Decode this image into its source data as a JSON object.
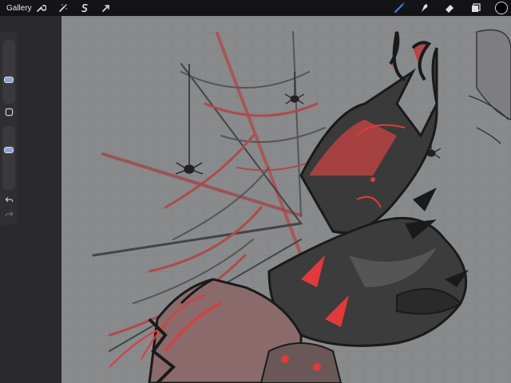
{
  "topbar": {
    "gallery_label": "Gallery",
    "left_tools": [
      {
        "name": "actions",
        "icon": "wrench-icon"
      },
      {
        "name": "adjustments",
        "icon": "magic-wand-icon"
      },
      {
        "name": "selection",
        "icon": "selection-s-icon"
      },
      {
        "name": "transform",
        "icon": "arrow-cursor-icon"
      }
    ],
    "right_tools": [
      {
        "name": "brush",
        "icon": "brush-icon",
        "active": true
      },
      {
        "name": "smudge",
        "icon": "smudge-icon"
      },
      {
        "name": "eraser",
        "icon": "eraser-icon"
      },
      {
        "name": "layers",
        "icon": "layers-icon"
      }
    ],
    "active_color": "#000000",
    "accent": "#4a7fe0"
  },
  "sidebar": {
    "brush_size_level": 0.5,
    "opacity_level": 0.5,
    "modify_button_icon": "square-icon",
    "undo_icon": "undo-icon",
    "redo_icon": "redo-icon"
  },
  "canvas": {
    "background": "#888a8c",
    "ink_red": "#e23a3a",
    "ink_dark": "#1e1e1e"
  }
}
